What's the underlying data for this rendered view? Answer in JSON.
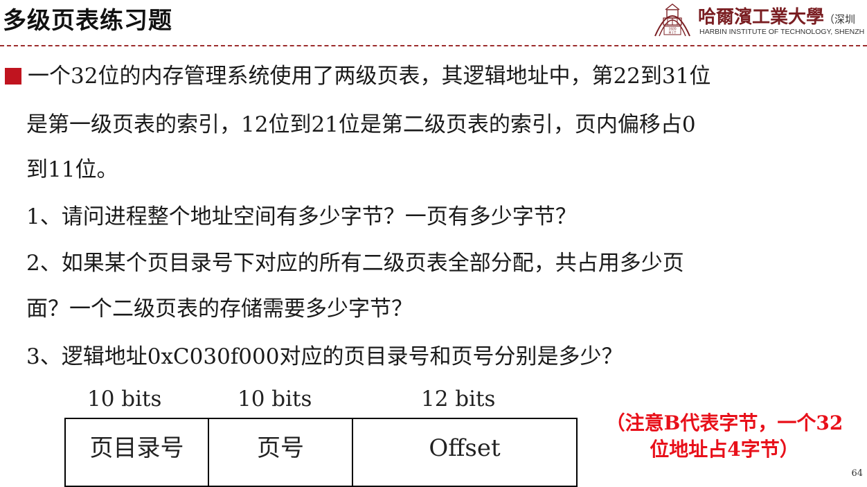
{
  "header": {
    "title": "多级页表练习题",
    "logo": {
      "name_cn": "哈爾濱工業大學",
      "name_cn_suffix": "（深圳",
      "name_en": "HARBIN INSTITUTE OF TECHNOLOGY, SHENZH",
      "emblem_text": "1920 HIT",
      "brand_color": "#7a1e22"
    }
  },
  "divider_color": "#9b2b2b",
  "bullet_color": "#c0141f",
  "body": {
    "lines": [
      "一个32位的内存管理系统使用了两级页表，其逻辑地址中，第22到31位",
      "是第一级页表的索引，12位到21位是第二级页表的索引，页内偏移占0",
      "到11位。",
      "1、请问进程整个地址空间有多少字节？一页有多少字节？",
      "2、如果某个页目录号下对应的所有二级页表全部分配，共占用多少页",
      "面？一个二级页表的存储需要多少字节？",
      "3、逻辑地址0xC030f000对应的页目录号和页号分别是多少？"
    ]
  },
  "address_format": {
    "bit_labels": [
      "10 bits",
      "10 bits",
      "12 bits"
    ],
    "fields": [
      "页目录号",
      "页号",
      "Offset"
    ]
  },
  "note": {
    "line1": "（注意B代表字节，一个32",
    "line2": "位地址占4字节）",
    "color": "#e8101a"
  },
  "page_number": "64"
}
